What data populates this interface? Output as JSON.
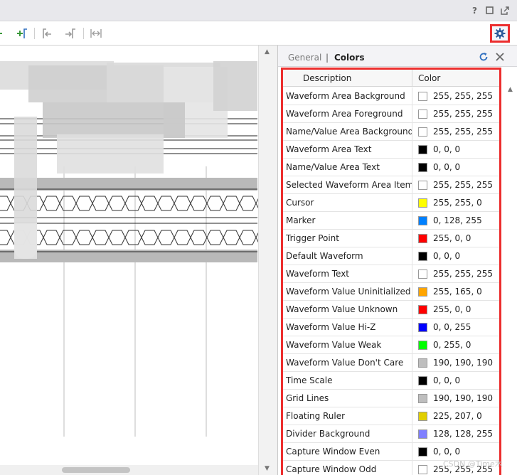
{
  "window": {
    "help_glyph": "?"
  },
  "panel": {
    "tabs": [
      {
        "label": "General"
      },
      {
        "label": "Colors"
      }
    ],
    "tab_separator": "|",
    "columns": [
      "Description",
      "Color"
    ],
    "rows": [
      {
        "description": "Waveform Area Background",
        "color": "255, 255, 255",
        "hex": "#ffffff"
      },
      {
        "description": "Waveform Area Foreground",
        "color": "255, 255, 255",
        "hex": "#ffffff"
      },
      {
        "description": "Name/Value Area Background",
        "color": "255, 255, 255",
        "hex": "#ffffff"
      },
      {
        "description": "Waveform Area Text",
        "color": "0, 0, 0",
        "hex": "#000000"
      },
      {
        "description": "Name/Value Area Text",
        "color": "0, 0, 0",
        "hex": "#000000"
      },
      {
        "description": "Selected Waveform Area Item",
        "color": "255, 255, 255",
        "hex": "#ffffff"
      },
      {
        "description": "Cursor",
        "color": "255, 255, 0",
        "hex": "#ffff00"
      },
      {
        "description": "Marker",
        "color": "0, 128, 255",
        "hex": "#0080ff"
      },
      {
        "description": "Trigger Point",
        "color": "255, 0, 0",
        "hex": "#ff0000"
      },
      {
        "description": "Default Waveform",
        "color": "0, 0, 0",
        "hex": "#000000"
      },
      {
        "description": "Waveform Text",
        "color": "255, 255, 255",
        "hex": "#ffffff"
      },
      {
        "description": "Waveform Value Uninitialized",
        "color": "255, 165, 0",
        "hex": "#ffa500"
      },
      {
        "description": "Waveform Value Unknown",
        "color": "255, 0, 0",
        "hex": "#ff0000"
      },
      {
        "description": "Waveform Value Hi-Z",
        "color": "0, 0, 255",
        "hex": "#0000ff"
      },
      {
        "description": "Waveform Value Weak",
        "color": "0, 255, 0",
        "hex": "#00ff00"
      },
      {
        "description": "Waveform Value Don't Care",
        "color": "190, 190, 190",
        "hex": "#bebebe"
      },
      {
        "description": "Time Scale",
        "color": "0, 0, 0",
        "hex": "#000000"
      },
      {
        "description": "Grid Lines",
        "color": "190, 190, 190",
        "hex": "#bebebe"
      },
      {
        "description": "Floating Ruler",
        "color": "225, 207, 0",
        "hex": "#e1cf00"
      },
      {
        "description": "Divider Background",
        "color": "128, 128, 255",
        "hex": "#8080ff"
      },
      {
        "description": "Capture Window Even",
        "color": "0, 0, 0",
        "hex": "#000000"
      },
      {
        "description": "Capture Window Odd",
        "color": "255, 255, 255",
        "hex": "#ffffff"
      }
    ],
    "watermark": "CSDN @Time木"
  },
  "colors": {
    "highlight": "#ec2e2e",
    "gear": "#2f5d9a",
    "toolbar_green": "#3a9a3a"
  },
  "icons": [
    "help-icon",
    "restore-icon",
    "popout-icon",
    "add-marker-icon",
    "goto-prev-marker-icon",
    "goto-next-marker-icon",
    "swap-cursor-icon",
    "settings-gear-icon",
    "refresh-icon",
    "close-icon"
  ]
}
